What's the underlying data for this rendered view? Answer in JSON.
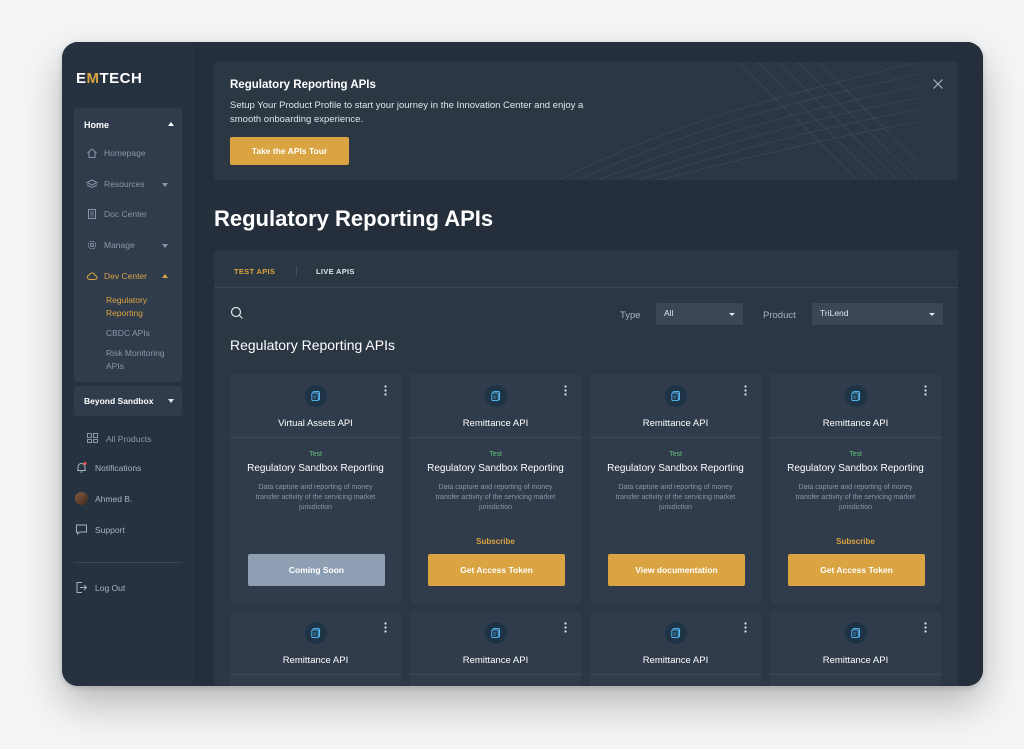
{
  "brand": {
    "prefix": "E",
    "accent": "M",
    "suffix": "TECH"
  },
  "sidebar": {
    "home_label": "Home",
    "items": [
      {
        "label": "Homepage",
        "icon": "home-icon"
      },
      {
        "label": "Resources",
        "icon": "layers-icon"
      },
      {
        "label": "Doc Center",
        "icon": "document-icon"
      },
      {
        "label": "Manage",
        "icon": "gear-icon"
      },
      {
        "label": "Dev Center",
        "icon": "cloud-icon"
      }
    ],
    "dev_sub": [
      "Regulatory Reporting",
      "CBDC APIs",
      "Risk Monitoring APIs"
    ],
    "beyond_label": "Beyond Sandbox",
    "all_products": "All Products",
    "notifications": "Notifications",
    "user": "Ahmed B.",
    "support": "Support",
    "logout": "Log Out"
  },
  "banner": {
    "title": "Regulatory Reporting APIs",
    "text": "Setup Your Product Profile to start your journey in the Innovation Center and enjoy a smooth onboarding experience.",
    "button": "Take the APIs Tour"
  },
  "page_title": "Regulatory Reporting APIs",
  "tabs": {
    "active": "TEST APIS",
    "inactive": "LIVE APIS"
  },
  "filters": {
    "type_label": "Type",
    "type_value": "All",
    "product_label": "Product",
    "product_value": "TriLend"
  },
  "section_title": "Regulatory Reporting APIs",
  "cards": [
    {
      "name": "Virtual Assets API",
      "env": "Test",
      "title": "Regulatory Sandbox Reporting",
      "desc": "Data capture and reporting of money transfer activity of the servicing market jurisdiction",
      "sub": "",
      "cta": "Coming Soon"
    },
    {
      "name": "Remittance API",
      "env": "Test",
      "title": "Regulatory Sandbox Reporting",
      "desc": "Data capture and reporting of money transfer activity of the servicing market jurisdiction",
      "sub": "Subscribe",
      "cta": "Get Access Token"
    },
    {
      "name": "Remittance API",
      "env": "Test",
      "title": "Regulatory Sandbox Reporting",
      "desc": "Data capture and reporting of money transfer activity of the servicing market jurisdiction",
      "sub": "",
      "cta": "View documentation"
    },
    {
      "name": "Remittance API",
      "env": "Test",
      "title": "Regulatory Sandbox Reporting",
      "desc": "Data capture and reporting of money transfer activity of the servicing market jurisdiction",
      "sub": "Subscribe",
      "cta": "Get Access Token"
    }
  ],
  "cards_row2": [
    {
      "name": "Remittance API"
    },
    {
      "name": "Remittance API"
    },
    {
      "name": "Remittance API"
    },
    {
      "name": "Remittance API"
    }
  ],
  "colors": {
    "accent": "#d9a441",
    "background": "#252f3c",
    "success": "#5fc27a"
  }
}
